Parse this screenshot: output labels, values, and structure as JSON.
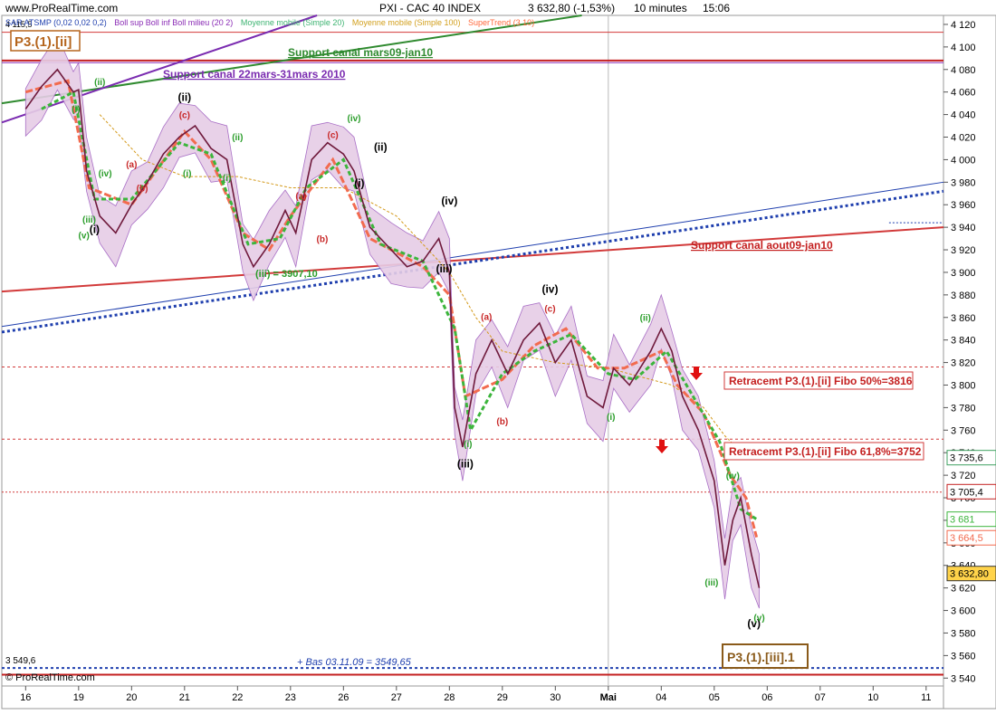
{
  "header": {
    "site": "www.ProRealTime.com",
    "title": "PXI - CAC 40 INDEX",
    "last": "3 632,80 (-1,53%)",
    "period": "10 minutes",
    "time": "15:06"
  },
  "legend": [
    {
      "text": "SAR ATSMP (0,02 0,02 0,2)",
      "color": "#1f3fae"
    },
    {
      "text": "Boll sup Boll inf Boll milieu (20 2)",
      "color": "#8a2bb5"
    },
    {
      "text": "Moyenne mobile (Simple 20)",
      "color": "#3cb371"
    },
    {
      "text": "Moyenne mobile (Simple 100)",
      "color": "#d2a01e"
    },
    {
      "text": "SuperTrend (3 10)",
      "color": "#ff6a3d"
    }
  ],
  "footer": {
    "watermark": "© ProRealTime.com",
    "left_value": "3 549,6",
    "left_top_value": "4 115,5"
  },
  "colors": {
    "price": "#6f1a3c",
    "boll_fill": "#e6cde6",
    "supertrend": "#f26b4f",
    "sma20": "#3cb53c",
    "sma100": "#d49a1c",
    "sar": "#1f3fae"
  },
  "chart_data": {
    "type": "line",
    "title": "PXI - CAC 40 INDEX",
    "x_ticks": [
      "16",
      "19",
      "20",
      "21",
      "22",
      "23",
      "26",
      "27",
      "28",
      "29",
      "30",
      "Mai",
      "04",
      "05",
      "06",
      "07",
      "10",
      "11"
    ],
    "y_ticks": [
      "4 120",
      "4 100",
      "4 080",
      "4 060",
      "4 040",
      "4 020",
      "4 000",
      "3 980",
      "3 960",
      "3 940",
      "3 920",
      "3 900",
      "3 880",
      "3 860",
      "3 840",
      "3 820",
      "3 800",
      "3 780",
      "3 760",
      "3 740",
      "3 720",
      "3 700",
      "3 680",
      "3 660",
      "3 640",
      "3 620",
      "3 600",
      "3 580",
      "3 560",
      "3 540"
    ],
    "ylim": [
      3533,
      4128
    ],
    "xlim": [
      0,
      17.7
    ],
    "series": [
      {
        "name": "CAC 40 (10 min)",
        "x": [
          0.0,
          0.3,
          0.6,
          0.9,
          1.0,
          1.15,
          1.4,
          1.7,
          2.0,
          2.3,
          2.6,
          2.9,
          3.2,
          3.5,
          3.8,
          4.1,
          4.3,
          4.6,
          4.9,
          5.1,
          5.4,
          5.7,
          6.0,
          6.2,
          6.5,
          6.9,
          7.2,
          7.5,
          7.8,
          8.0,
          8.1,
          8.25,
          8.5,
          8.8,
          9.1,
          9.4,
          9.7,
          10.0,
          10.3,
          10.6,
          10.9,
          11.1,
          11.4,
          11.8,
          12.0,
          12.2,
          12.4,
          12.7,
          13.0,
          13.2,
          13.35,
          13.5,
          13.7,
          13.85
        ],
        "y": [
          4045,
          4065,
          4080,
          4060,
          4062,
          3990,
          3950,
          3935,
          3960,
          3980,
          4005,
          4020,
          4030,
          4010,
          4000,
          3925,
          3905,
          3925,
          3955,
          3935,
          4000,
          4015,
          4005,
          3990,
          3940,
          3920,
          3905,
          3910,
          3930,
          3900,
          3780,
          3745,
          3810,
          3840,
          3810,
          3840,
          3855,
          3820,
          3840,
          3790,
          3780,
          3815,
          3800,
          3830,
          3850,
          3830,
          3790,
          3760,
          3715,
          3640,
          3680,
          3700,
          3650,
          3620
        ]
      },
      {
        "name": "SuperTrend (3 10)",
        "x": [
          0.0,
          0.8,
          1.2,
          2.0,
          3.0,
          3.5,
          4.1,
          4.6,
          5.0,
          5.8,
          6.5,
          7.5,
          8.0,
          8.3,
          9.0,
          9.6,
          10.2,
          10.8,
          11.3,
          12.0,
          12.3,
          12.8,
          13.3,
          13.6,
          13.8
        ],
        "y": [
          4060,
          4070,
          3975,
          3960,
          4025,
          4000,
          3935,
          3920,
          3950,
          4000,
          3930,
          3905,
          3880,
          3790,
          3805,
          3835,
          3850,
          3815,
          3815,
          3830,
          3800,
          3775,
          3720,
          3700,
          3665
        ]
      },
      {
        "name": "Moyenne mobile (Simple 100)",
        "x": [
          1.4,
          2.2,
          3.0,
          4.0,
          5.0,
          6.0,
          7.0,
          8.0,
          8.5,
          9.0,
          10.0,
          11.0,
          11.8,
          12.2,
          12.8,
          13.2,
          13.6
        ],
        "y": [
          4040,
          4000,
          3985,
          3985,
          3975,
          3975,
          3950,
          3900,
          3860,
          3830,
          3820,
          3815,
          3805,
          3800,
          3780,
          3755,
          3736
        ]
      },
      {
        "name": "Moyenne mobile (Simple 20)",
        "x": [
          0.3,
          0.9,
          1.3,
          2.0,
          2.9,
          3.5,
          4.2,
          4.8,
          5.3,
          6.0,
          6.7,
          7.5,
          8.1,
          8.4,
          9.0,
          9.6,
          10.3,
          11.0,
          11.5,
          12.1,
          12.6,
          13.1,
          13.5,
          13.8
        ],
        "y": [
          4045,
          4060,
          3965,
          3965,
          4015,
          4005,
          3925,
          3930,
          3975,
          4000,
          3925,
          3910,
          3850,
          3760,
          3810,
          3830,
          3845,
          3810,
          3805,
          3830,
          3790,
          3750,
          3690,
          3681
        ]
      }
    ],
    "price_labels": [
      "3 735,6",
      "3 705,4",
      "3 681",
      "3 664,5",
      "3 632,80"
    ],
    "annotations": [
      "Support canal mars09-jan10",
      "Support canal 22mars-31mars 2010",
      "Support canal aout09-jan10",
      "Retracemt P3.(1).[ii] Fibo 50%=3816",
      "Retracemt P3.(1).[ii] Fibo 61,8%=3752",
      "P3.(1).[ii]",
      "P3.(1).[iii].1",
      "+ Bas 03.11.09 = 3549,65",
      "(iii) = 3907,10"
    ],
    "wave_labels": [
      {
        "text": "(i)",
        "x": 1.3,
        "y": 3935,
        "color": "#000000"
      },
      {
        "text": "(ii)",
        "x": 3.0,
        "y": 4052,
        "color": "#000000"
      },
      {
        "text": "(iii)",
        "x": 8.3,
        "y": 3727,
        "color": "#000000"
      },
      {
        "text": "(iv)",
        "x": 9.9,
        "y": 3882,
        "color": "#000000"
      },
      {
        "text": "(v)",
        "x": 13.75,
        "y": 3585,
        "color": "#000000"
      },
      {
        "text": "(c)",
        "x": 3.0,
        "y": 4037,
        "color": "#c82828"
      },
      {
        "text": "(c)",
        "x": 5.8,
        "y": 4019,
        "color": "#c82828"
      },
      {
        "text": "(c)",
        "x": 9.9,
        "y": 3865,
        "color": "#c82828"
      },
      {
        "text": "(a)",
        "x": 2.0,
        "y": 3993,
        "color": "#c82828"
      },
      {
        "text": "(b)",
        "x": 2.2,
        "y": 3972,
        "color": "#c82828"
      },
      {
        "text": "(a)",
        "x": 5.2,
        "y": 3965,
        "color": "#c82828"
      },
      {
        "text": "(b)",
        "x": 5.6,
        "y": 3927,
        "color": "#c82828"
      },
      {
        "text": "(a)",
        "x": 8.7,
        "y": 3858,
        "color": "#c82828"
      },
      {
        "text": "(b)",
        "x": 9.0,
        "y": 3765,
        "color": "#c82828"
      },
      {
        "text": "(iv)",
        "x": 6.2,
        "y": 4034,
        "color": "#2a9d2a"
      },
      {
        "text": "(ii)",
        "x": 4.0,
        "y": 4017,
        "color": "#2a9d2a"
      },
      {
        "text": "(i)",
        "x": 3.8,
        "y": 3981,
        "color": "#2a9d2a"
      },
      {
        "text": "(ii)",
        "x": 11.7,
        "y": 3857,
        "color": "#2a9d2a"
      },
      {
        "text": "(i)",
        "x": 11.05,
        "y": 3769,
        "color": "#2a9d2a"
      },
      {
        "text": "(iv)",
        "x": 13.35,
        "y": 3717,
        "color": "#2a9d2a"
      },
      {
        "text": "(iii)",
        "x": 12.95,
        "y": 3622,
        "color": "#2a9d2a"
      },
      {
        "text": "(v)",
        "x": 13.85,
        "y": 3591,
        "color": "#2a9d2a"
      },
      {
        "text": "(iii)",
        "x": 1.2,
        "y": 3944,
        "color": "#2a9d2a"
      },
      {
        "text": "(v)",
        "x": 1.1,
        "y": 3930,
        "color": "#2a9d2a"
      },
      {
        "text": "(i)",
        "x": 0.95,
        "y": 4042,
        "color": "#2a9d2a"
      },
      {
        "text": "(ii)",
        "x": 1.4,
        "y": 4066,
        "color": "#2a9d2a"
      },
      {
        "text": "(iv)",
        "x": 1.5,
        "y": 3985,
        "color": "#2a9d2a"
      },
      {
        "text": "(i)",
        "x": 8.35,
        "y": 3745,
        "color": "#2a9d2a"
      },
      {
        "text": "(i)",
        "x": 3.05,
        "y": 3985,
        "color": "#2a9d2a"
      },
      {
        "text": "(iii)",
        "x": 7.9,
        "y": 3900,
        "color": "#000000"
      },
      {
        "text": "(iv)",
        "x": 8.0,
        "y": 3960,
        "color": "#000000"
      },
      {
        "text": "(i)",
        "x": 6.3,
        "y": 3976,
        "color": "#000000"
      },
      {
        "text": "(ii)",
        "x": 6.7,
        "y": 4008,
        "color": "#000000"
      }
    ],
    "grid": false,
    "legend_position": "top"
  }
}
